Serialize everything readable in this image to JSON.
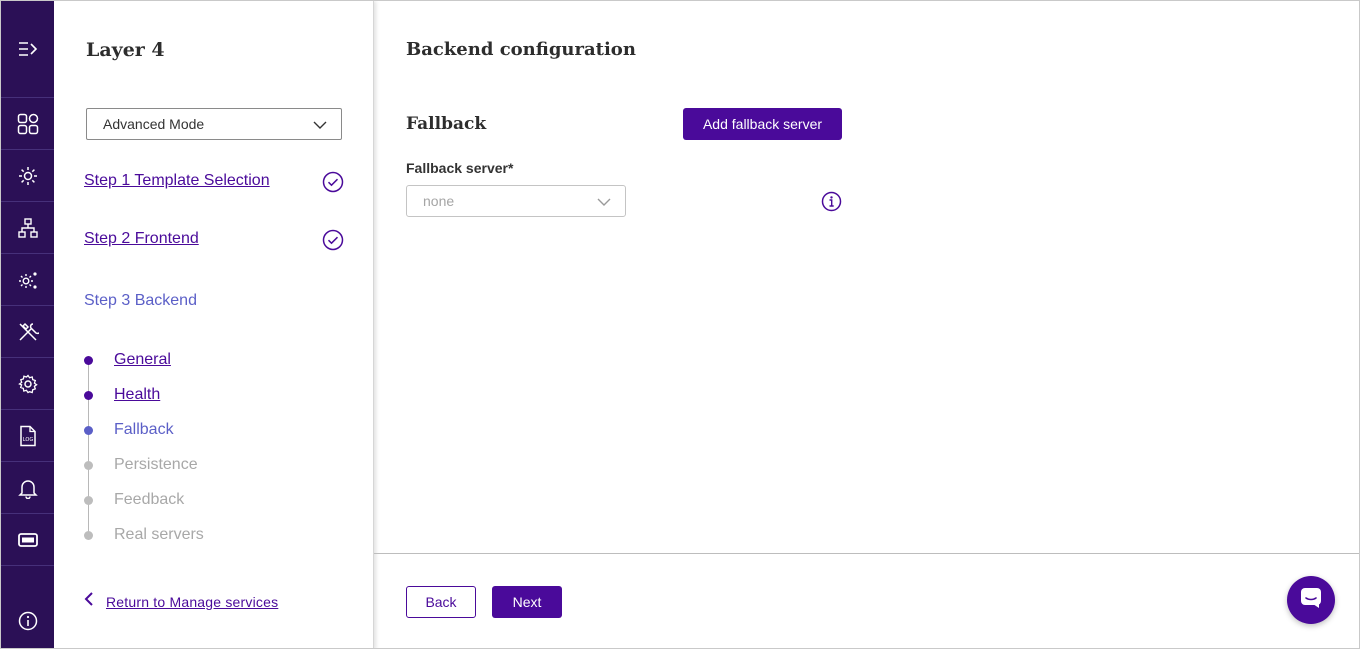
{
  "rail": {
    "items": [
      {
        "icon": "expand-menu-icon"
      },
      {
        "icon": "dashboard-icon"
      },
      {
        "icon": "services-gear-icon"
      },
      {
        "icon": "network-icon"
      },
      {
        "icon": "settings-cluster-icon"
      },
      {
        "icon": "tools-icon"
      },
      {
        "icon": "settings-icon"
      },
      {
        "icon": "log-file-icon"
      },
      {
        "icon": "bell-icon"
      },
      {
        "icon": "ticket-icon"
      }
    ],
    "bottom_icon": "info-icon"
  },
  "panel": {
    "title": "Layer 4",
    "mode_select": "Advanced Mode",
    "steps": [
      {
        "label": "Step 1 Template Selection",
        "status": "done"
      },
      {
        "label": "Step 2 Frontend",
        "status": "done"
      },
      {
        "label": "Step 3 Backend",
        "status": "current"
      }
    ],
    "substeps": [
      {
        "label": "General",
        "status": "done"
      },
      {
        "label": "Health",
        "status": "done"
      },
      {
        "label": "Fallback",
        "status": "active"
      },
      {
        "label": "Persistence",
        "status": "todo"
      },
      {
        "label": "Feedback",
        "status": "todo"
      },
      {
        "label": "Real servers",
        "status": "todo"
      }
    ],
    "return_link": "Return to Manage services"
  },
  "main": {
    "title": "Backend configuration",
    "section_title": "Fallback",
    "add_button": "Add fallback server",
    "field_label": "Fallback server*",
    "field_value": "none",
    "back_button": "Back",
    "next_button": "Next"
  },
  "colors": {
    "brand": "#4a0a9a",
    "rail_bg": "#2b1056",
    "active": "#5b5fc7",
    "inactive": "#bdbdbd"
  }
}
